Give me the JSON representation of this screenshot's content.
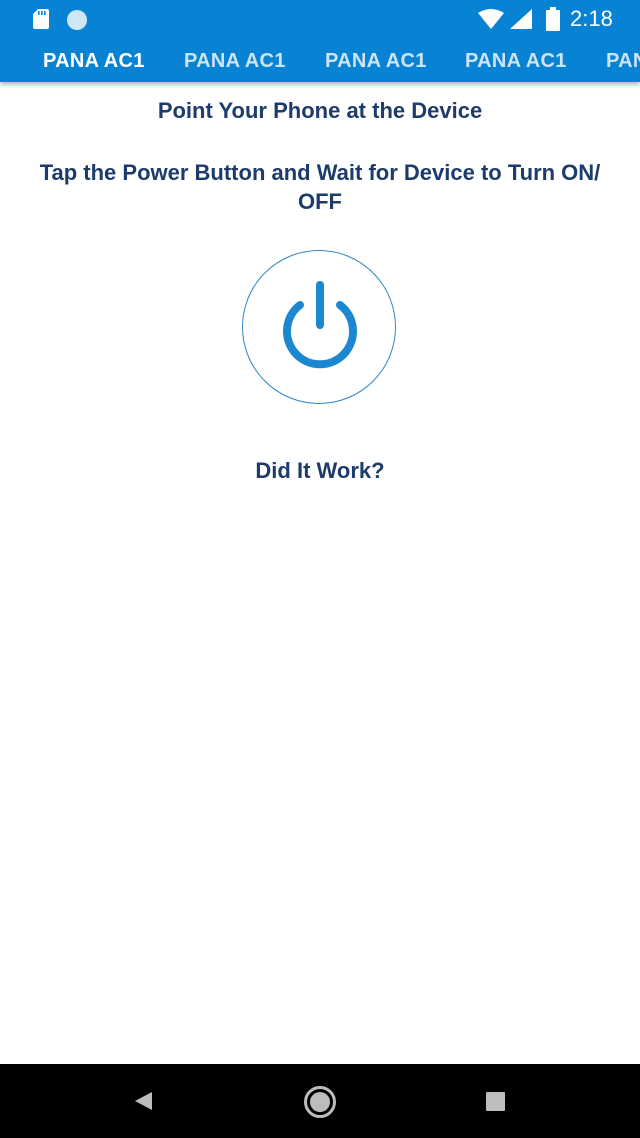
{
  "status_bar": {
    "time": "2:18",
    "icons": [
      "sd-card-icon",
      "notification-dot-icon",
      "wifi-icon",
      "signal-icon",
      "battery-icon"
    ]
  },
  "tabs": [
    {
      "label": "PANA AC1",
      "active": true
    },
    {
      "label": "PANA AC1",
      "active": false
    },
    {
      "label": "PANA AC1",
      "active": false
    },
    {
      "label": "PANA AC1",
      "active": false
    },
    {
      "label": "PAN",
      "active": false
    }
  ],
  "main": {
    "instruction_1": "Point Your Phone at the Device",
    "instruction_2": "Tap the Power Button and Wait for Device to Turn ON/ OFF",
    "power_icon": "power-icon",
    "feedback_question": "Did It Work?"
  },
  "nav_bar": {
    "icons": [
      "back-icon",
      "home-icon",
      "recents-icon"
    ]
  },
  "colors": {
    "header": "#0883d3",
    "text": "#1d3b6b",
    "power": "#1b87d0"
  }
}
